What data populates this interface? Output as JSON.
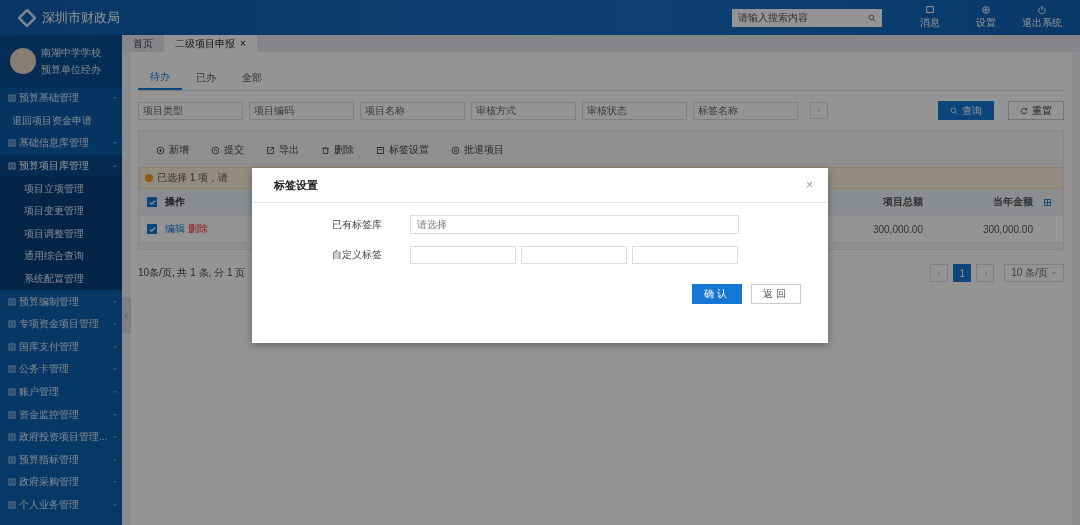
{
  "header": {
    "title": "深圳市财政局",
    "search": {
      "placeholder": "请输入搜索内容"
    },
    "actions": [
      {
        "kind": "message",
        "label": "消息"
      },
      {
        "kind": "settings",
        "label": "设置"
      },
      {
        "kind": "logout",
        "label": "退出系统"
      }
    ]
  },
  "user": {
    "name": "南湖中学学校",
    "role": "预算单位经办"
  },
  "sidebar": {
    "items": [
      {
        "kind": "group",
        "label": "预算基础管理",
        "expanded": false
      },
      {
        "kind": "link",
        "label": "退回项目资金申请"
      },
      {
        "kind": "group",
        "label": "基础信息库管理",
        "expanded": false
      },
      {
        "kind": "group",
        "label": "预算项目库管理",
        "expanded": true,
        "children": [
          {
            "label": "项目立项管理"
          },
          {
            "label": "项目变更管理"
          },
          {
            "label": "项目调整管理"
          },
          {
            "label": "通用综合查询"
          },
          {
            "label": "系统配置管理"
          }
        ]
      },
      {
        "kind": "group",
        "label": "预算编制管理",
        "expanded": false
      },
      {
        "kind": "group",
        "label": "专项资金项目管理",
        "expanded": false
      },
      {
        "kind": "group",
        "label": "国库支付管理",
        "expanded": false
      },
      {
        "kind": "group",
        "label": "公务卡管理",
        "expanded": false
      },
      {
        "kind": "group",
        "label": "账户管理",
        "expanded": false
      },
      {
        "kind": "group",
        "label": "资金监控管理",
        "expanded": false
      },
      {
        "kind": "group",
        "label": "政府投资项目管理...",
        "expanded": false
      },
      {
        "kind": "group",
        "label": "预算指标管理",
        "expanded": false
      },
      {
        "kind": "group",
        "label": "政府采购管理",
        "expanded": false
      },
      {
        "kind": "group",
        "label": "个人业务管理",
        "expanded": false
      }
    ]
  },
  "page_tabs": [
    {
      "label": "首页",
      "selected": false
    },
    {
      "label": "二级项目申报",
      "selected": true,
      "close": "×"
    }
  ],
  "sub_tabs": [
    {
      "label": "待办",
      "selected": true
    },
    {
      "label": "已办",
      "selected": false
    },
    {
      "label": "全部",
      "selected": false
    }
  ],
  "filters": [
    {
      "placeholder": "项目类型"
    },
    {
      "placeholder": "项目编码"
    },
    {
      "placeholder": "项目名称"
    },
    {
      "placeholder": "审核方式"
    },
    {
      "placeholder": "审核状态"
    },
    {
      "placeholder": "标签名称"
    }
  ],
  "search_button": "查询",
  "reset_button": "重置",
  "toolbar": [
    {
      "kind": "add",
      "label": "新增"
    },
    {
      "kind": "submit",
      "label": "提交"
    },
    {
      "kind": "export",
      "label": "导出"
    },
    {
      "kind": "delete",
      "label": "删除"
    },
    {
      "kind": "tag",
      "label": "标签设置"
    },
    {
      "kind": "batch",
      "label": "批退项目"
    }
  ],
  "alert": "已选择 1 项，请",
  "table": {
    "all_checked": true,
    "columns": [
      "操作",
      "项目总额",
      "当年金额"
    ],
    "rows": [
      {
        "checked": true,
        "edit": "编辑",
        "delete": "删除",
        "total": "300,000.00",
        "current": "300,000.00"
      }
    ]
  },
  "pagination": {
    "summary": "10条/页, 共 1 条, 分 1 页",
    "pages": [
      {
        "label": "1",
        "selected": true
      }
    ],
    "page_size": "10 条/页"
  },
  "dialog": {
    "title": "标签设置",
    "close": "×",
    "fields": [
      {
        "kind": "select",
        "label": "已有标签库",
        "placeholder": "请选择"
      },
      {
        "kind": "inputs",
        "label": "自定义标签"
      }
    ],
    "confirm": "确认",
    "back": "返回"
  }
}
